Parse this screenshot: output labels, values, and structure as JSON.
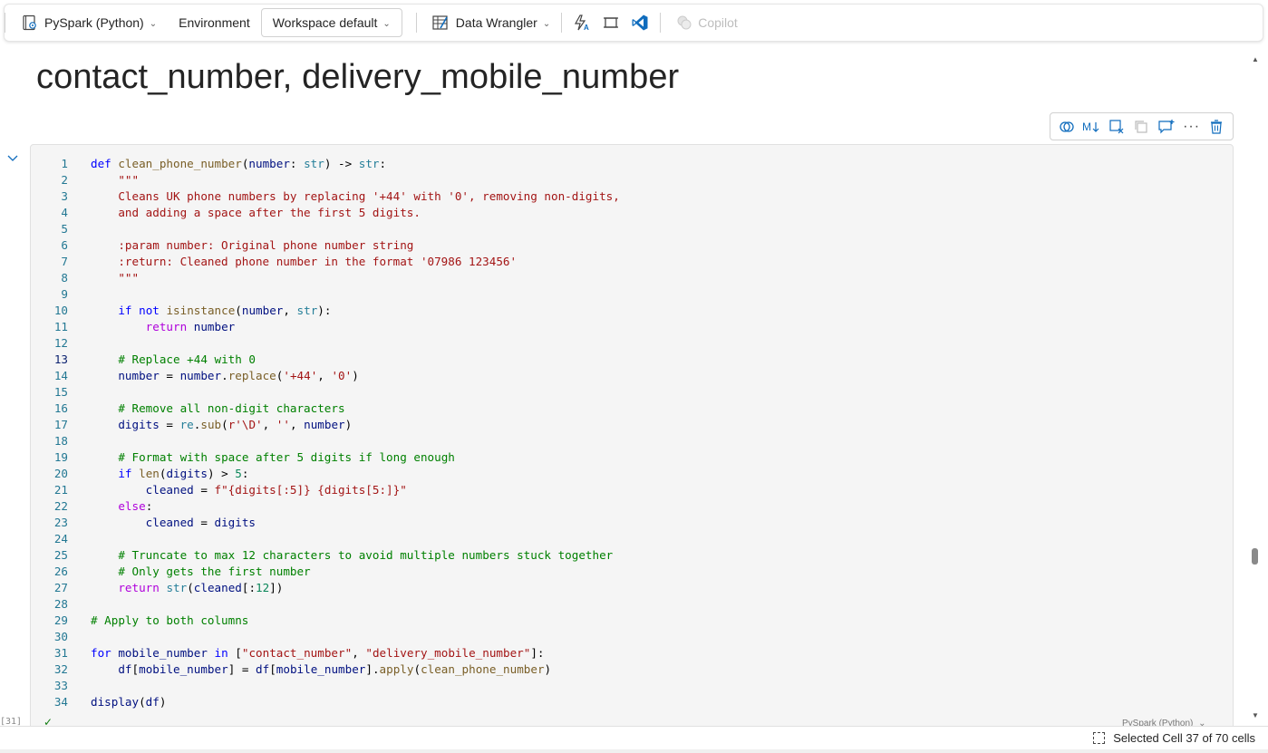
{
  "toolbar": {
    "language": "PySpark (Python)",
    "environment_label": "Environment",
    "workspace": "Workspace default",
    "data_wrangler": "Data Wrangler",
    "copilot": "Copilot"
  },
  "markdown": {
    "title": "contact_number, delivery_mobile_number"
  },
  "cell": {
    "exec_count": "[31]",
    "language_label": "PySpark (Python)",
    "current_line": 13
  },
  "code_lines": [
    "def clean_phone_number(number: str) -> str:",
    "    \"\"\"",
    "    Cleans UK phone numbers by replacing '+44' with '0', removing non-digits,",
    "    and adding a space after the first 5 digits.",
    "",
    "    :param number: Original phone number string",
    "    :return: Cleaned phone number in the format '07986 123456'",
    "    \"\"\"",
    "",
    "    if not isinstance(number, str):",
    "        return number",
    "",
    "    # Replace +44 with 0",
    "    number = number.replace('+44', '0')",
    "",
    "    # Remove all non-digit characters",
    "    digits = re.sub(r'\\D', '', number)",
    "",
    "    # Format with space after 5 digits if long enough",
    "    if len(digits) > 5:",
    "        cleaned = f\"{digits[:5]} {digits[5:]}\"",
    "    else:",
    "        cleaned = digits",
    "",
    "    # Truncate to max 12 characters to avoid multiple numbers stuck together",
    "    # Only gets the first number",
    "    return str(cleaned[:12])",
    "",
    "# Apply to both columns",
    "",
    "for mobile_number in [\"contact_number\", \"delivery_mobile_number\"]:",
    "    df[mobile_number] = df[mobile_number].apply(clean_phone_number)",
    "",
    "display(df)"
  ],
  "status": {
    "selection": "Selected Cell 37 of 70 cells"
  }
}
